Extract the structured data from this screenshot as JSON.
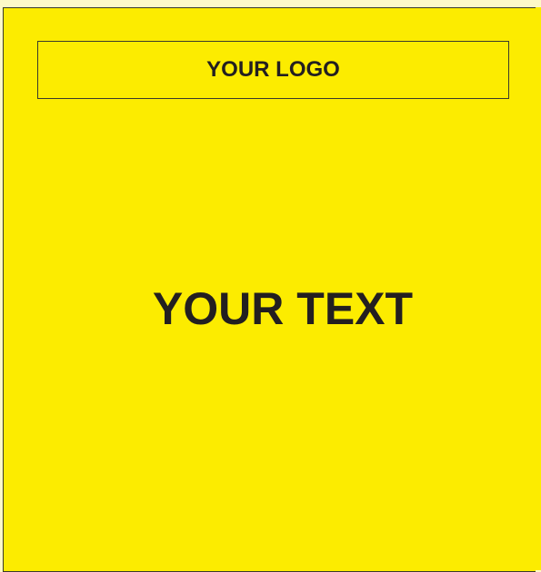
{
  "logo": {
    "text": "YOUR LOGO"
  },
  "main": {
    "text": "YOUR TEXT"
  },
  "colors": {
    "background": "#fcec00",
    "text": "#231f20",
    "border": "#3a3a2a"
  }
}
